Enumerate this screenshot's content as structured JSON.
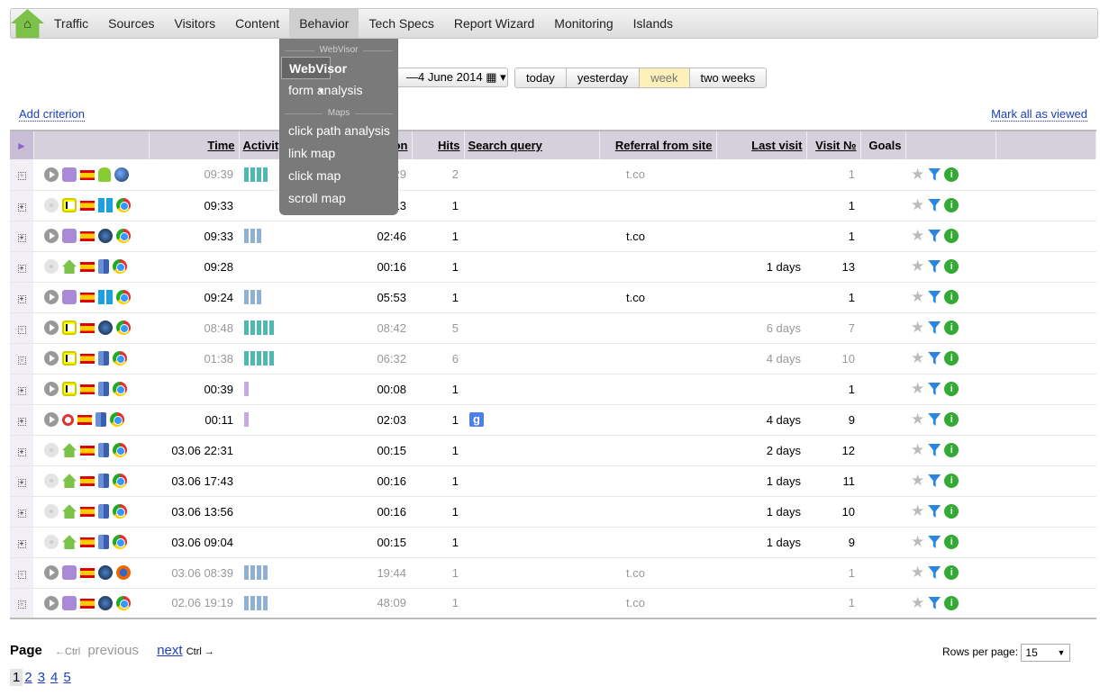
{
  "nav": {
    "home_icon": "home-icon",
    "items": [
      "Traffic",
      "Sources",
      "Visitors",
      "Content",
      "Behavior",
      "Tech Specs",
      "Report Wizard",
      "Monitoring",
      "Islands"
    ],
    "active": "Behavior"
  },
  "menu": {
    "section1": "WebVisor",
    "webvisor": "WebVisor",
    "form_analysis": "form analysis",
    "section2": "Maps",
    "click_path": "click path analysis",
    "link_map": "link map",
    "click_map": "click map",
    "scroll_map": "scroll map"
  },
  "date": {
    "range": "—4 June 2014",
    "calendar_icon": "▦ ▾"
  },
  "periods": [
    "today",
    "yesterday",
    "week",
    "two weeks"
  ],
  "period_active": "week",
  "add_criterion": "Add criterion",
  "mark_all": "Mark all as viewed",
  "columns": {
    "time": "Time",
    "activity": "Activity",
    "duration": "Duration",
    "hits": "Hits",
    "search": "Search query",
    "referral": "Referral from site",
    "last_visit": "Last visit",
    "visit_no": "Visit №",
    "goals": "Goals"
  },
  "colors": {
    "teal": "#4fb8b4",
    "blue": "#8fb0d4",
    "purple": "#c8a8e0"
  },
  "rows": [
    {
      "viewed": true,
      "play": true,
      "src": "user",
      "os": "android",
      "br": "globe",
      "time": "09:39",
      "bars": 4,
      "bc": "teal",
      "dur": "29",
      "hits": "2",
      "search": "",
      "ref": "t.co",
      "last": "",
      "no": "1"
    },
    {
      "viewed": false,
      "play": false,
      "src": "win",
      "os": "windows",
      "br": "chrome",
      "time": "09:33",
      "bars": 0,
      "bc": "",
      "dur": "13",
      "hits": "1",
      "search": "",
      "ref": "",
      "last": "",
      "no": "1"
    },
    {
      "viewed": false,
      "play": true,
      "src": "user",
      "os": "win7",
      "br": "chrome",
      "time": "09:33",
      "bars": 3,
      "bc": "blue",
      "dur": "02:46",
      "hits": "1",
      "search": "",
      "ref": "t.co",
      "last": "",
      "no": "1"
    },
    {
      "viewed": false,
      "play": false,
      "src": "home",
      "os": "mac",
      "br": "chrome",
      "time": "09:28",
      "bars": 0,
      "bc": "",
      "dur": "00:16",
      "hits": "1",
      "search": "",
      "ref": "",
      "last": "1 days",
      "no": "13"
    },
    {
      "viewed": false,
      "play": true,
      "src": "user",
      "os": "windows",
      "br": "chrome",
      "time": "09:24",
      "bars": 3,
      "bc": "blue",
      "dur": "05:53",
      "hits": "1",
      "search": "",
      "ref": "t.co",
      "last": "",
      "no": "1"
    },
    {
      "viewed": true,
      "play": true,
      "src": "win",
      "os": "win7",
      "br": "chrome",
      "time": "08:48",
      "bars": 5,
      "bc": "teal",
      "dur": "08:42",
      "hits": "5",
      "search": "",
      "ref": "",
      "last": "6 days",
      "no": "7"
    },
    {
      "viewed": true,
      "play": true,
      "src": "win",
      "os": "mac",
      "br": "chrome",
      "time": "01:38",
      "bars": 5,
      "bc": "teal",
      "dur": "06:32",
      "hits": "6",
      "search": "",
      "ref": "",
      "last": "4 days",
      "no": "10"
    },
    {
      "viewed": false,
      "play": true,
      "src": "win",
      "os": "mac",
      "br": "chrome",
      "time": "00:39",
      "bars": 1,
      "bc": "purple",
      "dur": "00:08",
      "hits": "1",
      "search": "",
      "ref": "",
      "last": "",
      "no": "1"
    },
    {
      "viewed": false,
      "play": true,
      "src": "srch",
      "os": "mac",
      "br": "chrome",
      "time": "00:11",
      "bars": 1,
      "bc": "purple",
      "dur": "02:03",
      "hits": "1",
      "search": "g",
      "ref": "",
      "last": "4 days",
      "no": "9"
    },
    {
      "viewed": false,
      "play": false,
      "src": "home",
      "os": "mac",
      "br": "chrome",
      "time": "03.06 22:31",
      "bars": 0,
      "bc": "",
      "dur": "00:15",
      "hits": "1",
      "search": "",
      "ref": "",
      "last": "2 days",
      "no": "12"
    },
    {
      "viewed": false,
      "play": false,
      "src": "home",
      "os": "mac",
      "br": "chrome",
      "time": "03.06 17:43",
      "bars": 0,
      "bc": "",
      "dur": "00:16",
      "hits": "1",
      "search": "",
      "ref": "",
      "last": "1 days",
      "no": "11"
    },
    {
      "viewed": false,
      "play": false,
      "src": "home",
      "os": "mac",
      "br": "chrome",
      "time": "03.06 13:56",
      "bars": 0,
      "bc": "",
      "dur": "00:16",
      "hits": "1",
      "search": "",
      "ref": "",
      "last": "1 days",
      "no": "10"
    },
    {
      "viewed": false,
      "play": false,
      "src": "home",
      "os": "mac",
      "br": "chrome",
      "time": "03.06 09:04",
      "bars": 0,
      "bc": "",
      "dur": "00:15",
      "hits": "1",
      "search": "",
      "ref": "",
      "last": "1 days",
      "no": "9"
    },
    {
      "viewed": true,
      "play": true,
      "src": "user",
      "os": "win7",
      "br": "firefox",
      "time": "03.06 08:39",
      "bars": 4,
      "bc": "blue",
      "dur": "19:44",
      "hits": "1",
      "search": "",
      "ref": "t.co",
      "last": "",
      "no": "1"
    },
    {
      "viewed": true,
      "play": true,
      "src": "user",
      "os": "win7",
      "br": "chrome",
      "time": "02.06 19:19",
      "bars": 4,
      "bc": "blue",
      "dur": "48:09",
      "hits": "1",
      "search": "",
      "ref": "t.co",
      "last": "",
      "no": "1"
    }
  ],
  "pager": {
    "page": "Page",
    "prev_key": "←Ctrl",
    "previous": "previous",
    "next": "next",
    "next_key": "Ctrl →",
    "pages": [
      "1",
      "2",
      "3",
      "4",
      "5"
    ],
    "current": "1",
    "rows_label": "Rows per page:",
    "rows_value": "15"
  }
}
